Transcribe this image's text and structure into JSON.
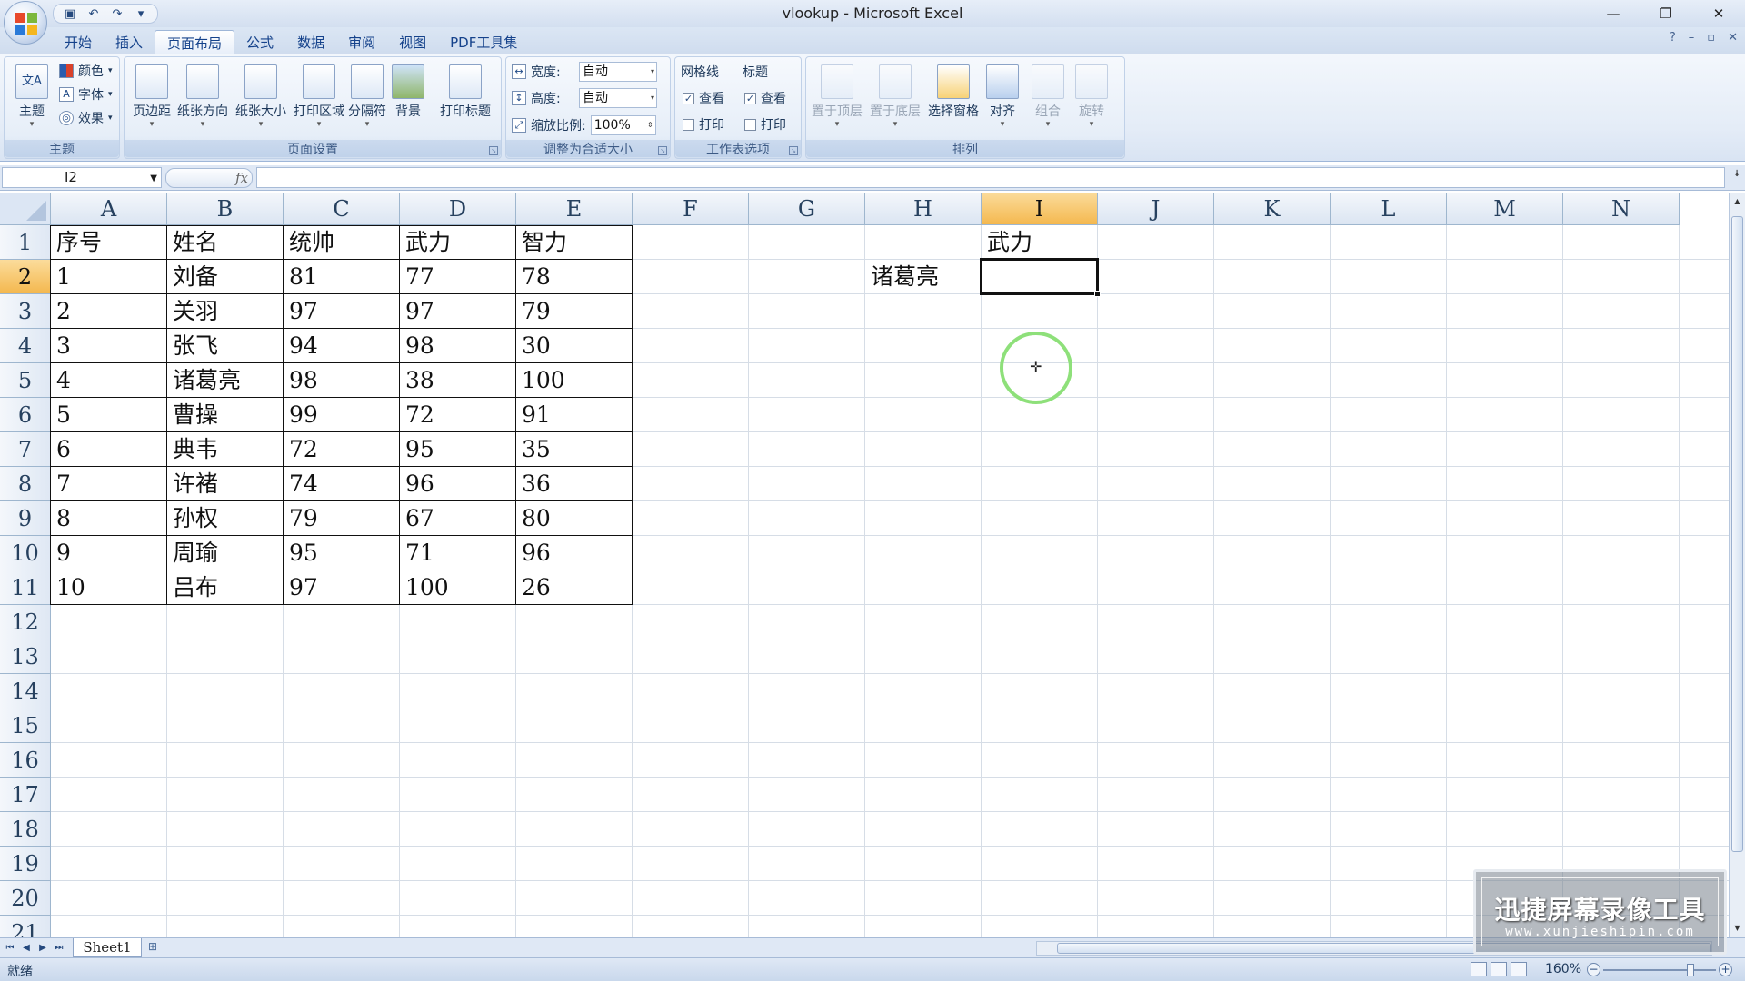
{
  "window": {
    "title": "vlookup - Microsoft Excel",
    "controls": {
      "minimize": "—",
      "restore": "❐",
      "close": "✕"
    }
  },
  "ribbon_tabs": [
    "开始",
    "插入",
    "页面布局",
    "公式",
    "数据",
    "审阅",
    "视图",
    "PDF工具集"
  ],
  "active_tab": "页面布局",
  "ribbon": {
    "themes": {
      "label": "主题",
      "theme_btn": "主题",
      "colors": "颜色",
      "fonts": "字体",
      "effects": "效果"
    },
    "page_setup": {
      "label": "页面设置",
      "margins": "页边距",
      "orientation": "纸张方向",
      "size": "纸张大小",
      "print_area": "打印区域",
      "breaks": "分隔符",
      "background": "背景",
      "print_titles": "打印标题"
    },
    "scale_to_fit": {
      "label": "调整为合适大小",
      "width_label": "宽度:",
      "width_value": "自动",
      "height_label": "高度:",
      "height_value": "自动",
      "scale_label": "缩放比例:",
      "scale_value": "100%"
    },
    "sheet_options": {
      "label": "工作表选项",
      "gridlines": "网格线",
      "headings": "标题",
      "view": "查看",
      "print": "打印"
    },
    "arrange": {
      "label": "排列",
      "bring_front": "置于顶层",
      "send_back": "置于底层",
      "selection_pane": "选择窗格",
      "align": "对齐",
      "group": "组合",
      "rotate": "旋转"
    }
  },
  "formula_bar": {
    "name_box": "I2",
    "fx": "fx",
    "formula": ""
  },
  "columns": [
    "A",
    "B",
    "C",
    "D",
    "E",
    "F",
    "G",
    "H",
    "I",
    "J",
    "K",
    "L",
    "M",
    "N"
  ],
  "rows": [
    "1",
    "2",
    "3",
    "4",
    "5",
    "6",
    "7",
    "8",
    "9",
    "10",
    "11",
    "12",
    "13",
    "14",
    "15",
    "16",
    "17",
    "18",
    "19",
    "20",
    "21"
  ],
  "selected_cell": "I2",
  "table": {
    "headers": [
      "序号",
      "姓名",
      "统帅",
      "武力",
      "智力"
    ],
    "rows": [
      [
        "1",
        "刘备",
        "81",
        "77",
        "78"
      ],
      [
        "2",
        "关羽",
        "97",
        "97",
        "79"
      ],
      [
        "3",
        "张飞",
        "94",
        "98",
        "30"
      ],
      [
        "4",
        "诸葛亮",
        "98",
        "38",
        "100"
      ],
      [
        "5",
        "曹操",
        "99",
        "72",
        "91"
      ],
      [
        "6",
        "典韦",
        "72",
        "95",
        "35"
      ],
      [
        "7",
        "许褚",
        "74",
        "96",
        "36"
      ],
      [
        "8",
        "孙权",
        "79",
        "67",
        "80"
      ],
      [
        "9",
        "周瑜",
        "95",
        "71",
        "96"
      ],
      [
        "10",
        "吕布",
        "97",
        "100",
        "26"
      ]
    ]
  },
  "lookup": {
    "header": "武力",
    "name": "诸葛亮"
  },
  "sheet_tabs": [
    "Sheet1"
  ],
  "status": {
    "text": "就绪",
    "zoom": "160%"
  },
  "watermark": {
    "line1": "迅捷屏幕录像工具",
    "line2": "www.xunjieshipin.com"
  }
}
